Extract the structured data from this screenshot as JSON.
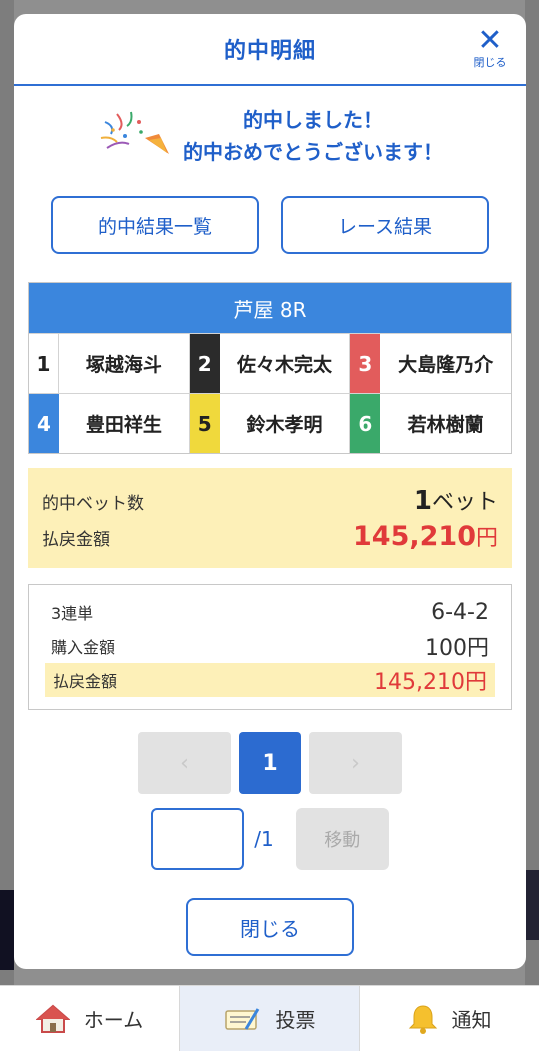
{
  "modal": {
    "title": "的中明細",
    "close_label": "閉じる",
    "congrats_line1": "的中しました！",
    "congrats_line2": "的中おめでとうございます！",
    "btn_results_list": "的中結果一覧",
    "btn_race_results": "レース結果"
  },
  "race": {
    "header": "芦屋 8R",
    "racers": [
      {
        "lane": "1",
        "name": "塚越海斗"
      },
      {
        "lane": "2",
        "name": "佐々木完太"
      },
      {
        "lane": "3",
        "name": "大島隆乃介"
      },
      {
        "lane": "4",
        "name": "豊田祥生"
      },
      {
        "lane": "5",
        "name": "鈴木孝明"
      },
      {
        "lane": "6",
        "name": "若林樹蘭"
      }
    ]
  },
  "summary": {
    "bets_label": "的中ベット数",
    "bets_count": "1",
    "bets_unit": "ベット",
    "payout_label": "払戻金額",
    "payout_value": "145,210",
    "payout_unit": "円"
  },
  "detail": {
    "type_label": "3連単",
    "type_value": "6-4-2",
    "purchase_label": "購入金額",
    "purchase_value": "100円",
    "payout_label": "払戻金額",
    "payout_value": "145,210円"
  },
  "pager": {
    "prev": "‹",
    "current": "1",
    "next": "›",
    "total": "/1",
    "move_label": "移動",
    "input_value": ""
  },
  "close_button": "閉じる",
  "tabbar": {
    "home": "ホーム",
    "vote": "投票",
    "notify": "通知"
  },
  "colors": {
    "accent": "#2f6fd4",
    "race_header": "#3b86dd",
    "payout_red": "#e03a3a",
    "highlight": "#fdf0b8"
  }
}
